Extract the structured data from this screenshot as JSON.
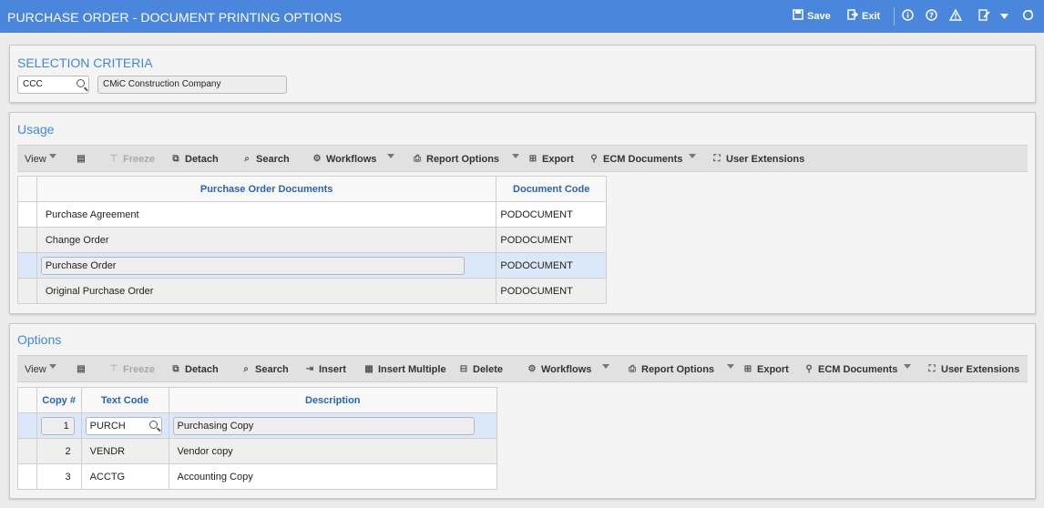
{
  "window": {
    "title": "PURCHASE ORDER - DOCUMENT PRINTING OPTIONS"
  },
  "header_actions": {
    "save": "Save",
    "exit": "Exit"
  },
  "selection": {
    "title": "SELECTION CRITERIA",
    "company_code": "CCC",
    "company_name": "CMiC Construction Company"
  },
  "usage": {
    "title": "Usage",
    "toolbar": {
      "view": "View",
      "freeze": "Freeze",
      "detach": "Detach",
      "search": "Search",
      "workflows": "Workflows",
      "report_options": "Report Options",
      "export": "Export",
      "ecm_documents": "ECM Documents",
      "user_extensions": "User Extensions"
    },
    "columns": [
      "Purchase Order Documents",
      "Document Code"
    ],
    "rows": [
      {
        "document": "Purchase Agreement",
        "code": "PODOCUMENT"
      },
      {
        "document": "Change Order",
        "code": "PODOCUMENT"
      },
      {
        "document": "Purchase Order",
        "code": "PODOCUMENT",
        "selected": true
      },
      {
        "document": "Original Purchase Order",
        "code": "PODOCUMENT"
      }
    ]
  },
  "options": {
    "title": "Options",
    "toolbar": {
      "view": "View",
      "freeze": "Freeze",
      "detach": "Detach",
      "search": "Search",
      "insert": "Insert",
      "insert_multiple": "Insert Multiple",
      "delete": "Delete",
      "workflows": "Workflows",
      "report_options": "Report Options",
      "export": "Export",
      "ecm_documents": "ECM Documents",
      "user_extensions": "User Extensions"
    },
    "columns": [
      "Copy #",
      "Text Code",
      "Description"
    ],
    "rows": [
      {
        "copy": "1",
        "text_code": "PURCH",
        "description": "Purchasing Copy",
        "selected": true
      },
      {
        "copy": "2",
        "text_code": "VENDR",
        "description": "Vendor copy"
      },
      {
        "copy": "3",
        "text_code": "ACCTG",
        "description": "Accounting Copy"
      }
    ]
  },
  "colors": {
    "header_blue": "#4a86dc",
    "title_blue": "#3f88d8",
    "column_header": "#2864b4",
    "selected_row": "#dbe8fa"
  }
}
